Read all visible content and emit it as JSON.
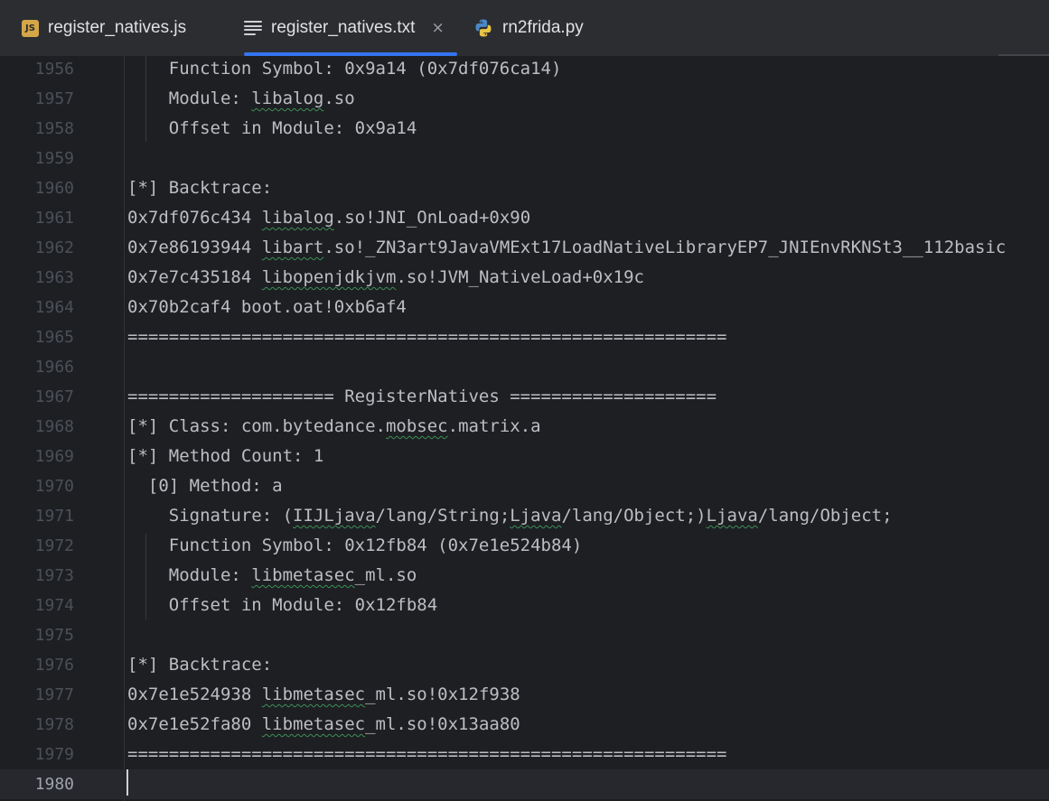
{
  "tabs": [
    {
      "label": "register_natives.js",
      "icon": "js-icon",
      "active": false
    },
    {
      "label": "register_natives.txt",
      "icon": "text-file-icon",
      "active": true,
      "close_glyph": "×"
    },
    {
      "label": "rn2frida.py",
      "icon": "python-icon",
      "active": false
    }
  ],
  "js_badge": "JS",
  "colors": {
    "tab_bar_bg": "#2b2d30",
    "editor_bg": "#1e1f22",
    "active_tab_underline": "#3574f0",
    "text": "#bcbec4",
    "line_number": "#4b5059",
    "squiggle": "#3d8f58"
  },
  "editor": {
    "current_line": "1980",
    "lines": [
      {
        "num": "1956",
        "segs": [
          {
            "t": "    Function Symbol: 0x9a14 (0x7df076ca14)"
          }
        ]
      },
      {
        "num": "1957",
        "segs": [
          {
            "t": "    Module: "
          },
          {
            "t": "libalog",
            "sq": true
          },
          {
            "t": ".so"
          }
        ]
      },
      {
        "num": "1958",
        "segs": [
          {
            "t": "    Offset in Module: 0x9a14"
          }
        ]
      },
      {
        "num": "1959",
        "segs": []
      },
      {
        "num": "1960",
        "segs": [
          {
            "t": "[*] Backtrace:"
          }
        ]
      },
      {
        "num": "1961",
        "segs": [
          {
            "t": "0x7df076c434 "
          },
          {
            "t": "libalog",
            "sq": true
          },
          {
            "t": ".so!JNI_OnLoad+0x90"
          }
        ]
      },
      {
        "num": "1962",
        "segs": [
          {
            "t": "0x7e86193944 "
          },
          {
            "t": "libart",
            "sq": true
          },
          {
            "t": ".so!_ZN3art9JavaVMExt17LoadNativeLibraryEP7_JNIEnvRKNSt3__112basic"
          }
        ]
      },
      {
        "num": "1963",
        "segs": [
          {
            "t": "0x7e7c435184 "
          },
          {
            "t": "libopenjdkjvm",
            "sq": true
          },
          {
            "t": ".so!JVM_NativeLoad+0x19c"
          }
        ]
      },
      {
        "num": "1964",
        "segs": [
          {
            "t": "0x70b2caf4 boot.oat!0xb6af4"
          }
        ]
      },
      {
        "num": "1965",
        "segs": [
          {
            "t": "=========================================================="
          }
        ]
      },
      {
        "num": "1966",
        "segs": []
      },
      {
        "num": "1967",
        "segs": [
          {
            "t": "==================== RegisterNatives ===================="
          }
        ]
      },
      {
        "num": "1968",
        "segs": [
          {
            "t": "[*] Class: com.bytedance."
          },
          {
            "t": "mobsec",
            "sq": true
          },
          {
            "t": ".matrix.a"
          }
        ]
      },
      {
        "num": "1969",
        "segs": [
          {
            "t": "[*] Method Count: 1"
          }
        ]
      },
      {
        "num": "1970",
        "segs": [
          {
            "t": "  [0] Method: a"
          }
        ]
      },
      {
        "num": "1971",
        "segs": [
          {
            "t": "    Signature: ("
          },
          {
            "t": "IIJLjava",
            "sq": true
          },
          {
            "t": "/lang/String;"
          },
          {
            "t": "Ljava",
            "sq": true
          },
          {
            "t": "/lang/Object;)"
          },
          {
            "t": "Ljava",
            "sq": true
          },
          {
            "t": "/lang/Object;"
          }
        ]
      },
      {
        "num": "1972",
        "segs": [
          {
            "t": "    Function Symbol: 0x12fb84 (0x7e1e524b84)"
          }
        ]
      },
      {
        "num": "1973",
        "segs": [
          {
            "t": "    Module: "
          },
          {
            "t": "libmetasec",
            "sq": true
          },
          {
            "t": "_ml.so"
          }
        ]
      },
      {
        "num": "1974",
        "segs": [
          {
            "t": "    Offset in Module: 0x12fb84"
          }
        ]
      },
      {
        "num": "1975",
        "segs": []
      },
      {
        "num": "1976",
        "segs": [
          {
            "t": "[*] Backtrace:"
          }
        ]
      },
      {
        "num": "1977",
        "segs": [
          {
            "t": "0x7e1e524938 "
          },
          {
            "t": "libmetasec",
            "sq": true
          },
          {
            "t": "_ml.so!0x12f938"
          }
        ]
      },
      {
        "num": "1978",
        "segs": [
          {
            "t": "0x7e1e52fa80 "
          },
          {
            "t": "libmetasec",
            "sq": true
          },
          {
            "t": "_ml.so!0x13aa80"
          }
        ]
      },
      {
        "num": "1979",
        "segs": [
          {
            "t": "=========================================================="
          }
        ]
      },
      {
        "num": "1980",
        "segs": []
      }
    ]
  }
}
